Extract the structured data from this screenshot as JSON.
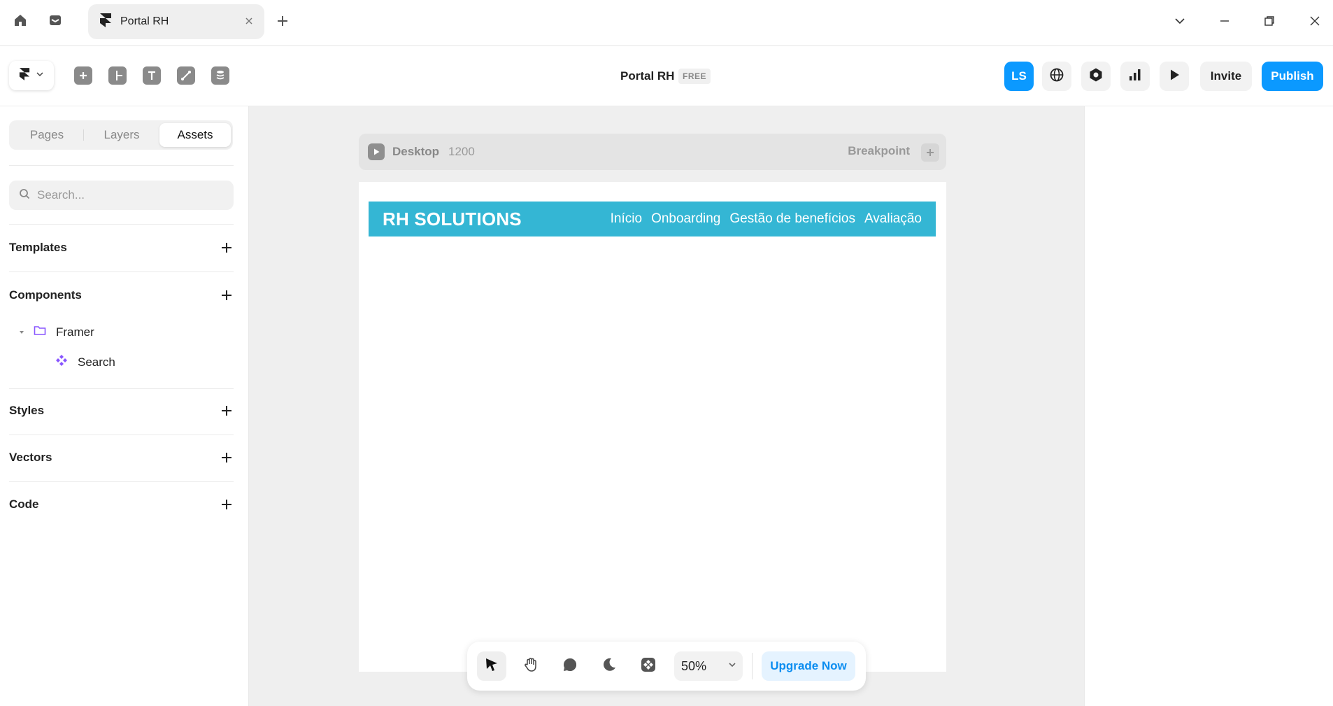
{
  "window": {
    "tab_title": "Portal RH",
    "icons": [
      "home-icon",
      "inbox-icon",
      "framer-logo-icon",
      "close-icon",
      "plus-icon",
      "chevron-down-icon",
      "minimize-icon",
      "restore-icon",
      "window-close-icon"
    ]
  },
  "toolbar": {
    "insert_tools": [
      "insert-icon",
      "layout-icon",
      "text-icon",
      "vector-icon",
      "cms-icon"
    ],
    "project_title": "Portal RH",
    "plan_badge": "FREE",
    "avatar_initials": "LS",
    "right_icons": [
      "globe-icon",
      "settings-hex-icon",
      "analytics-icon",
      "play-icon"
    ],
    "invite_label": "Invite",
    "publish_label": "Publish",
    "accent_color": "#0b99ff"
  },
  "left_panel": {
    "tabs": [
      {
        "label": "Pages",
        "active": false
      },
      {
        "label": "Layers",
        "active": false
      },
      {
        "label": "Assets",
        "active": true
      }
    ],
    "search_placeholder": "Search...",
    "sections": [
      {
        "label": "Templates"
      },
      {
        "label": "Components"
      },
      {
        "label": "Styles"
      },
      {
        "label": "Vectors"
      },
      {
        "label": "Code"
      }
    ],
    "components_tree": {
      "folder": "Framer",
      "item": "Search"
    }
  },
  "canvas": {
    "breakpoint": {
      "name": "Desktop",
      "width": "1200",
      "label": "Breakpoint"
    },
    "site": {
      "logo": "RH SOLUTIONS",
      "nav_links": [
        "Início",
        "Onboarding",
        "Gestão de benefícios",
        "Avaliação"
      ],
      "nav_color": "#34b6d4"
    }
  },
  "bottom_bar": {
    "tools": [
      "select-icon",
      "hand-icon",
      "comment-icon",
      "dark-mode-icon",
      "components-icon"
    ],
    "zoom": "50%",
    "upgrade_label": "Upgrade Now"
  }
}
